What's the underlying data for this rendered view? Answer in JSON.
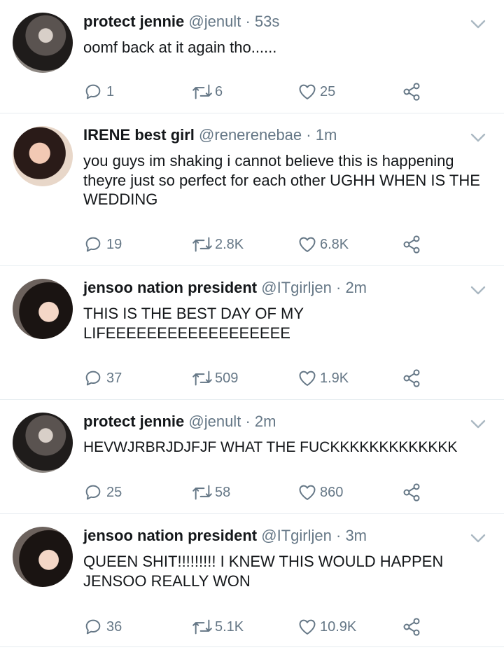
{
  "tweets": [
    {
      "name": "protect jennie",
      "handle": "@jenult",
      "separator": "·",
      "time": "53s",
      "text": "oomf back at it again tho......",
      "replies": "1",
      "retweets": "6",
      "likes": "25",
      "avatar_icon": "avatar-photo",
      "avatar_style": "a1"
    },
    {
      "name": "IRENE best girl",
      "handle": "@renerenebae",
      "separator": "·",
      "time": "1m",
      "text": "you guys im shaking i cannot believe this is happening theyre just so perfect for each other UGHH WHEN IS THE WEDDING",
      "replies": "19",
      "retweets": "2.8K",
      "likes": "6.8K",
      "avatar_icon": "avatar-photo",
      "avatar_style": "a2"
    },
    {
      "name": "jensoo nation president",
      "handle": "@ITgirljen",
      "separator": "·",
      "time": "2m",
      "text": "THIS IS THE BEST DAY OF MY LIFEEEEEEEEEEEEEEEEEE",
      "replies": "37",
      "retweets": "509",
      "likes": "1.9K",
      "avatar_icon": "avatar-photo",
      "avatar_style": "a3"
    },
    {
      "name": "protect jennie",
      "handle": "@jenult",
      "separator": "·",
      "time": "2m",
      "text": "HEVWJRBRJDJFJF WHAT THE FUCKKKKKKKKKKKKK",
      "replies": "25",
      "retweets": "58",
      "likes": "860",
      "avatar_icon": "avatar-photo",
      "avatar_style": "a1"
    },
    {
      "name": "jensoo nation president",
      "handle": "@ITgirljen",
      "separator": "·",
      "time": "3m",
      "text": "QUEEN SHIT!!!!!!!!! I KNEW THIS WOULD HAPPEN JENSOO REALLY WON",
      "replies": "36",
      "retweets": "5.1K",
      "likes": "10.9K",
      "avatar_icon": "avatar-photo",
      "avatar_style": "a3"
    }
  ],
  "icons": {
    "reply": "reply-icon",
    "retweet": "retweet-icon",
    "like": "heart-icon",
    "share": "share-icon",
    "caret": "chevron-down-icon"
  },
  "colors": {
    "text": "#14171a",
    "secondary": "#657786",
    "divider": "#e6ecf0"
  }
}
